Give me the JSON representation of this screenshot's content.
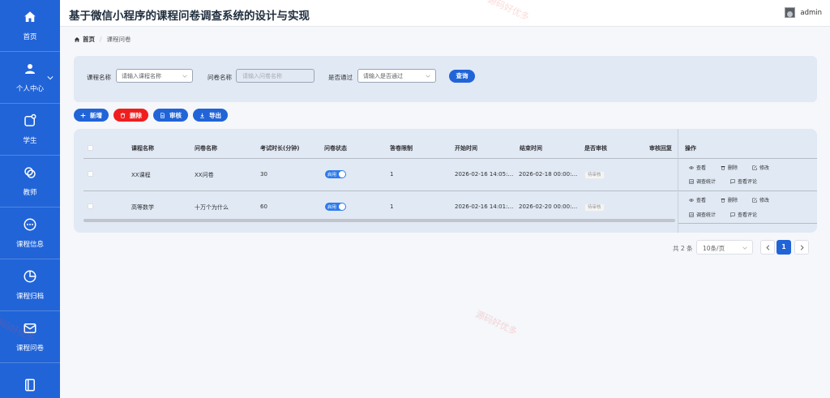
{
  "app": {
    "title": "基于微信小程序的课程问卷调查系统的设计与实现"
  },
  "user": {
    "name": "admin"
  },
  "sidebar": {
    "items": [
      {
        "label": "首页",
        "icon": "home-icon"
      },
      {
        "label": "个人中心",
        "icon": "user-icon"
      },
      {
        "label": "学生",
        "icon": "student-icon"
      },
      {
        "label": "教师",
        "icon": "teacher-icon"
      },
      {
        "label": "课程信息",
        "icon": "chat-icon"
      },
      {
        "label": "课程归档",
        "icon": "pie-icon"
      },
      {
        "label": "课程问卷",
        "icon": "mail-icon"
      },
      {
        "label": "",
        "icon": "notebook-icon"
      }
    ]
  },
  "breadcrumb": {
    "home": "首页",
    "current": "课程问卷"
  },
  "search": {
    "course_label": "课程名称",
    "course_placeholder": "请输入课程名称",
    "survey_label": "问卷名称",
    "survey_placeholder": "请输入问卷名称",
    "pass_label": "是否通过",
    "pass_placeholder": "请输入是否通过",
    "query_button": "查询"
  },
  "toolbar": {
    "add": "新增",
    "delete": "删除",
    "review": "审核",
    "export": "导出"
  },
  "table": {
    "columns": [
      "课程名称",
      "问卷名称",
      "考试时长(分钟)",
      "问卷状态",
      "答卷限制",
      "开始时间",
      "结束时间",
      "是否审核",
      "审核回复",
      "操作"
    ],
    "rows": [
      {
        "course": "XX课程",
        "survey": "XX问卷",
        "duration": "30",
        "status": "启用",
        "limit": "1",
        "start": "2026-02-16 14:05:…",
        "end": "2026-02-18 00:00:…",
        "review": "待审核",
        "reply": ""
      },
      {
        "course": "高等数学",
        "survey": "十万个为什么",
        "duration": "60",
        "status": "启用",
        "limit": "1",
        "start": "2026-02-16 14:01:…",
        "end": "2026-02-20 00:00:…",
        "review": "待审核",
        "reply": ""
      }
    ],
    "ops": {
      "view": "查看",
      "delete": "删除",
      "edit": "修改",
      "stats": "调查统计",
      "comments": "查看评论"
    }
  },
  "pagination": {
    "total": "共 2 条",
    "page_size": "10条/页",
    "current_page": "1"
  },
  "watermark": "源码好优多",
  "colors": {
    "primary": "#2164d8",
    "danger": "#f01e1e",
    "panel": "#e1e9f4"
  }
}
